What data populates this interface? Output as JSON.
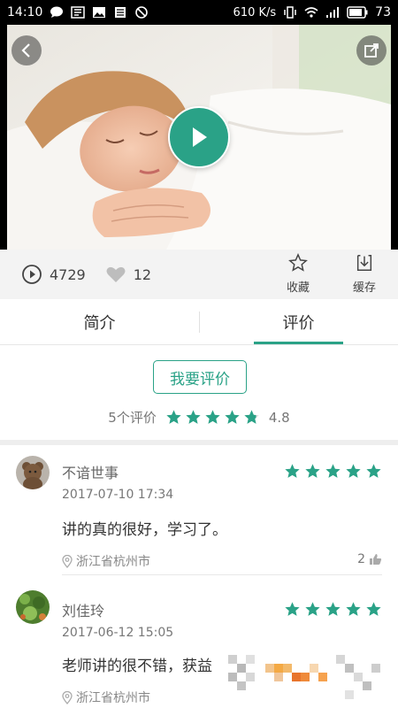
{
  "status_bar": {
    "time": "14:10",
    "net_speed": "610 K/s",
    "battery": "73"
  },
  "video": {
    "colors": {
      "accent": "#2aa287"
    }
  },
  "stats": {
    "play_count": "4729",
    "like_count": "12",
    "favorite_label": "收藏",
    "download_label": "缓存"
  },
  "tabs": [
    {
      "label": "简介"
    },
    {
      "label": "评价"
    }
  ],
  "rating": {
    "button_label": "我要评价",
    "count_text": "5个评价",
    "score": "4.8",
    "stars": 4.8
  },
  "reviews": [
    {
      "name": "不谙世事",
      "date": "2017-07-10 17:34",
      "content": "讲的真的很好，学习了。",
      "location": "浙江省杭州市",
      "likes": "2",
      "stars": 5
    },
    {
      "name": "刘佳玲",
      "date": "2017-06-12 15:05",
      "content": "老师讲的很不错，获益",
      "location": "浙江省杭州市",
      "stars": 5
    }
  ]
}
